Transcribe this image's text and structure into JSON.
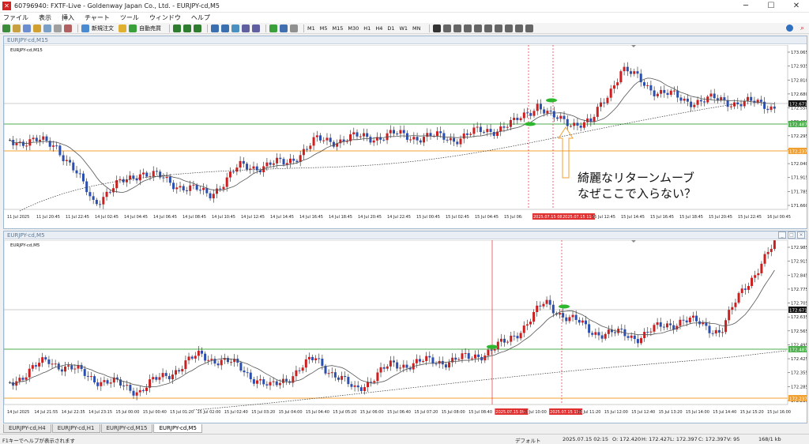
{
  "window": {
    "title": "60796940: FXTF-Live - Goldenway Japan Co., Ltd. - EURJPY-cd,M5"
  },
  "menu": [
    "ファイル",
    "表示",
    "挿入",
    "チャート",
    "ツール",
    "ウィンドウ",
    "ヘルプ"
  ],
  "toolbar": {
    "new_order": "新規注文",
    "auto_trade": "自動売買",
    "timeframes": [
      "M1",
      "M5",
      "M15",
      "M30",
      "H1",
      "H4",
      "D1",
      "W1",
      "MN"
    ]
  },
  "chart_top": {
    "window_label": "EURJPY-cd,M15",
    "symbol_label": "EURJPY-cd,M15",
    "price_ticks": [
      "173.065",
      "172.935",
      "172.810",
      "172.680",
      "172.550",
      "172.420",
      "172.295",
      "172.165",
      "172.040",
      "171.915",
      "171.785",
      "171.660"
    ],
    "current_price": "172.671",
    "green_level": "172.487",
    "orange_level": "172.237",
    "time_ticks": [
      "11 Jul 2025",
      "11 Jul 20:45",
      "11 Jul 22:45",
      "14 Jul 02:45",
      "14 Jul 04:45",
      "14 Jul 06:45",
      "14 Jul 08:45",
      "14 Jul 10:45",
      "14 Jul 12:45",
      "14 Jul 14:45",
      "14 Jul 16:45",
      "14 Jul 18:45",
      "14 Jul 20:45",
      "14 Jul 22:45",
      "15 Jul 00:45",
      "15 Jul 02:45",
      "15 Jul 04:45",
      "15 Jul 06:",
      "2025.07.15 08:15",
      "2025.07.15 11:00",
      "15 Jul 12:45",
      "15 Jul 14:45",
      "15 Jul 16:45",
      "15 Jul 18:45",
      "15 Jul 20:45",
      "15 Jul 22:45",
      "16 Jul 00:45"
    ],
    "annotation": [
      "綺麗なリターンムーブ",
      "なぜここで入らない？"
    ]
  },
  "chart_bottom": {
    "window_label": "EURJPY-cd,M5",
    "symbol_label": "EURJPY-cd,M5",
    "price_ticks": [
      "172.985",
      "172.915",
      "172.845",
      "172.775",
      "172.705",
      "172.635",
      "172.565",
      "172.495",
      "172.425",
      "172.355",
      "172.285",
      "172.215"
    ],
    "current_price": "172.671",
    "green_level": "172.487",
    "orange_level": "172.237",
    "time_ticks": [
      "14 Jul 2025",
      "14 Jul 21:55",
      "14 Jul 22:35",
      "14 Jul 23:15",
      "15 Jul 00:00",
      "15 Jul 00:40",
      "15 Jul 01:20",
      "15 Jul 02:00",
      "15 Jul 02:40",
      "15 Jul 03:20",
      "15 Jul 04:00",
      "15 Jul 04:40",
      "15 Jul 05:20",
      "15 Jul 06:00",
      "15 Jul 06:40",
      "15 Jul 07:20",
      "15 Jul 08:00",
      "15 Jul 08:40",
      "2025.07.15 09:15",
      "15 Jul 10:00",
      "2025.07.15 11:00",
      "15 Jul 11:20",
      "15 Jul 12:00",
      "15 Jul 12:40",
      "15 Jul 13:20",
      "15 Jul 14:00",
      "15 Jul 14:40",
      "15 Jul 15:20",
      "15 Jul 16:00"
    ]
  },
  "tabs": [
    "EURJPY-cd,H4",
    "EURJPY-cd,H1",
    "EURJPY-cd,M15",
    "EURJPY-cd,M5"
  ],
  "status": {
    "help": "F1キーでヘルプが表示されます",
    "profile": "デフォルト",
    "datetime": "2025.07.15 02:15",
    "open": "O: 172.420",
    "high": "H: 172.427",
    "low": "L: 172.397",
    "close": "C: 172.397",
    "volume": "V: 95",
    "traffic": "168/1 kb"
  },
  "colors": {
    "bull": "#cc1f1f",
    "bear": "#2a4fb0",
    "green_line": "#4cae4c",
    "orange_line": "#f0a030",
    "red_vline": "#e03030"
  }
}
